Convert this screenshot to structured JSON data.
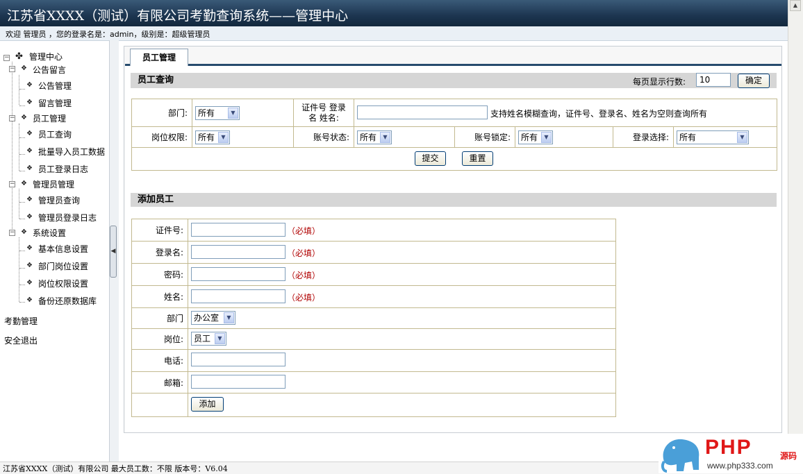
{
  "header": {
    "title": "江苏省XXXX（测试）有限公司考勤查询系统——管理中心",
    "welcome": "欢迎 管理员 ，您的登录名是：admin，级别是：超级管理员"
  },
  "sidebar": {
    "root": "管理中心",
    "groups": [
      {
        "label": "公告留言",
        "items": [
          "公告管理",
          "留言管理"
        ]
      },
      {
        "label": "员工管理",
        "items": [
          "员工查询",
          "批量导入员工数据",
          "员工登录日志"
        ]
      },
      {
        "label": "管理员管理",
        "items": [
          "管理员查询",
          "管理员登录日志"
        ]
      },
      {
        "label": "系统设置",
        "items": [
          "基本信息设置",
          "部门岗位设置",
          "岗位权限设置",
          "备份还原数据库"
        ]
      }
    ],
    "bottom": [
      "考勤管理",
      "安全退出"
    ]
  },
  "tabs": [
    {
      "label": "员工管理"
    }
  ],
  "query": {
    "title": "员工查询",
    "page_size_label": "每页显示行数:",
    "page_size_value": "10",
    "confirm_label": "确定",
    "dept_label": "部门:",
    "dept_value": "所有",
    "id_label_line1": "证件号 登录",
    "id_label_line2": "名 姓名:",
    "search_hint": "支持姓名模糊查询，证件号、登录名、姓名为空则查询所有",
    "perm_label": "岗位权限:",
    "perm_value": "所有",
    "status_label": "账号状态:",
    "status_value": "所有",
    "lock_label": "账号锁定:",
    "lock_value": "所有",
    "login_label": "登录选择:",
    "login_value": "所有",
    "submit_label": "提交",
    "reset_label": "重置"
  },
  "add": {
    "title": "添加员工",
    "required": "（必填）",
    "fields": {
      "id_label": "证件号:",
      "login_label": "登录名:",
      "password_label": "密码:",
      "name_label": "姓名:",
      "dept_label": "部门",
      "dept_value": "办公室",
      "post_label": "岗位:",
      "post_value": "员工",
      "phone_label": "电话:",
      "email_label": "邮箱:"
    },
    "add_label": "添加"
  },
  "status_bar": {
    "text": "江苏省XXXX（测试）有限公司  最大员工数：不限  版本号：V6.04"
  },
  "watermark": {
    "brand": "PHP",
    "zh": "源码",
    "url": "www.php333.com"
  },
  "colors": {
    "header_bg": "#1c3550",
    "section_bg": "#d6d6d6",
    "required": "#b00000",
    "tab_line": "#274b6d"
  }
}
